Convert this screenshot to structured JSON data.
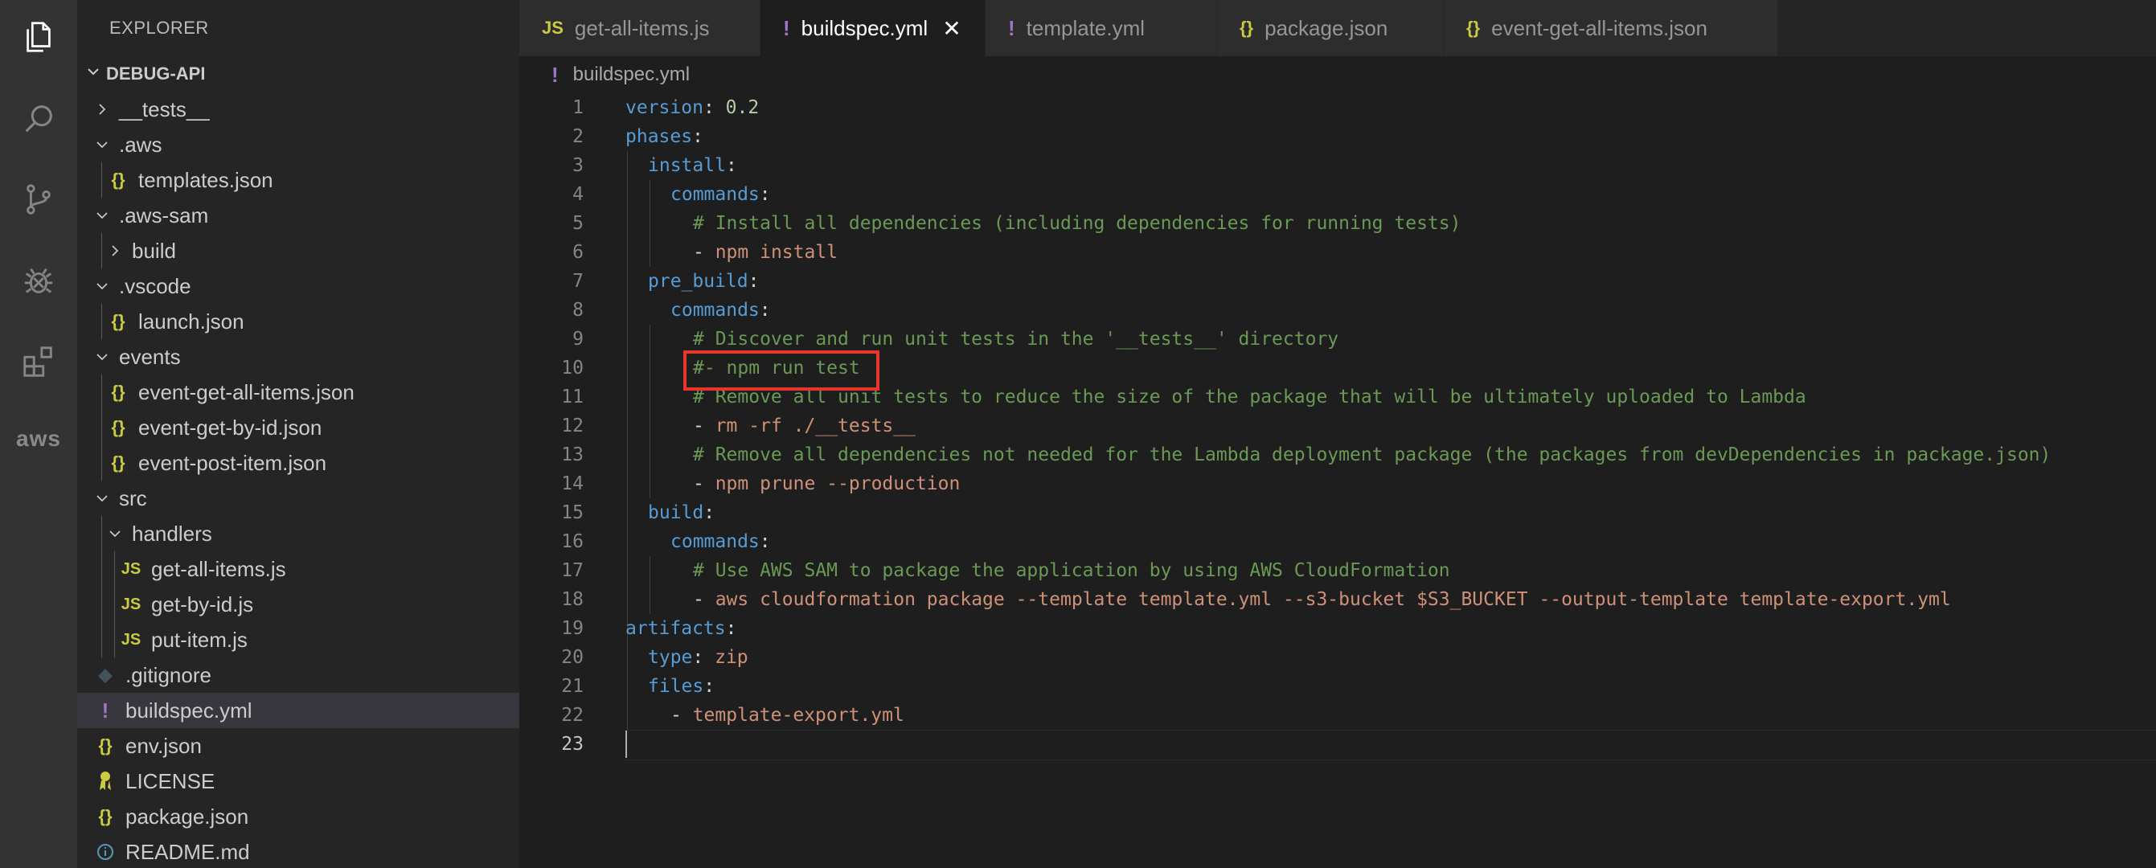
{
  "sidebar": {
    "title": "EXPLORER",
    "section": "DEBUG-API",
    "items": [
      {
        "label": "__tests__",
        "type": "folder-closed",
        "depth": 1
      },
      {
        "label": ".aws",
        "type": "folder-open",
        "depth": 1
      },
      {
        "label": "templates.json",
        "type": "json",
        "depth": 2
      },
      {
        "label": ".aws-sam",
        "type": "folder-open",
        "depth": 1
      },
      {
        "label": "build",
        "type": "folder-closed",
        "depth": 2
      },
      {
        "label": ".vscode",
        "type": "folder-open",
        "depth": 1
      },
      {
        "label": "launch.json",
        "type": "json",
        "depth": 2
      },
      {
        "label": "events",
        "type": "folder-open",
        "depth": 1
      },
      {
        "label": "event-get-all-items.json",
        "type": "json",
        "depth": 2
      },
      {
        "label": "event-get-by-id.json",
        "type": "json",
        "depth": 2
      },
      {
        "label": "event-post-item.json",
        "type": "json",
        "depth": 2
      },
      {
        "label": "src",
        "type": "folder-open",
        "depth": 1
      },
      {
        "label": "handlers",
        "type": "folder-open",
        "depth": 2
      },
      {
        "label": "get-all-items.js",
        "type": "js",
        "depth": 3
      },
      {
        "label": "get-by-id.js",
        "type": "js",
        "depth": 3
      },
      {
        "label": "put-item.js",
        "type": "js",
        "depth": 3
      },
      {
        "label": ".gitignore",
        "type": "git",
        "depth": 1
      },
      {
        "label": "buildspec.yml",
        "type": "yml",
        "depth": 1,
        "selected": true
      },
      {
        "label": "env.json",
        "type": "json",
        "depth": 1
      },
      {
        "label": "LICENSE",
        "type": "license",
        "depth": 1
      },
      {
        "label": "package.json",
        "type": "json",
        "depth": 1
      },
      {
        "label": "README.md",
        "type": "info",
        "depth": 1
      }
    ]
  },
  "tabs": [
    {
      "label": "get-all-items.js",
      "type": "js",
      "active": false
    },
    {
      "label": "buildspec.yml",
      "type": "yml",
      "active": true
    },
    {
      "label": "template.yml",
      "type": "yml",
      "active": false
    },
    {
      "label": "package.json",
      "type": "json",
      "active": false
    },
    {
      "label": "event-get-all-items.json",
      "type": "json",
      "active": false
    }
  ],
  "icons": {
    "json": "{}",
    "js": "JS",
    "yml": "!",
    "close": "✕"
  },
  "breadcrumb": "buildspec.yml",
  "activity_bar": {
    "aws_label": "aws"
  },
  "editor": {
    "active_line": 23,
    "highlighted_line": 10,
    "lines": [
      {
        "n": "1",
        "indent": 0,
        "tokens": [
          [
            "k",
            "version"
          ],
          [
            "p",
            ": "
          ],
          [
            "v",
            "0.2"
          ]
        ]
      },
      {
        "n": "2",
        "indent": 0,
        "tokens": [
          [
            "k",
            "phases"
          ],
          [
            "p",
            ":"
          ]
        ]
      },
      {
        "n": "3",
        "indent": 1,
        "tokens": [
          [
            "k",
            "install"
          ],
          [
            "p",
            ":"
          ]
        ]
      },
      {
        "n": "4",
        "indent": 2,
        "tokens": [
          [
            "k",
            "commands"
          ],
          [
            "p",
            ":"
          ]
        ]
      },
      {
        "n": "5",
        "indent": 3,
        "tokens": [
          [
            "c",
            "# Install all dependencies (including dependencies for running tests)"
          ]
        ]
      },
      {
        "n": "6",
        "indent": 3,
        "tokens": [
          [
            "p",
            "- "
          ],
          [
            "s",
            "npm install"
          ]
        ]
      },
      {
        "n": "7",
        "indent": 1,
        "tokens": [
          [
            "k",
            "pre_build"
          ],
          [
            "p",
            ":"
          ]
        ]
      },
      {
        "n": "8",
        "indent": 2,
        "tokens": [
          [
            "k",
            "commands"
          ],
          [
            "p",
            ":"
          ]
        ]
      },
      {
        "n": "9",
        "indent": 3,
        "tokens": [
          [
            "c",
            "# Discover and run unit tests in the '__tests__' directory"
          ]
        ]
      },
      {
        "n": "10",
        "indent": 3,
        "tokens": [
          [
            "c",
            "#- npm run test"
          ]
        ]
      },
      {
        "n": "11",
        "indent": 3,
        "tokens": [
          [
            "c",
            "# Remove all unit tests to reduce the size of the package that will be ultimately uploaded to Lambda"
          ]
        ]
      },
      {
        "n": "12",
        "indent": 3,
        "tokens": [
          [
            "p",
            "- "
          ],
          [
            "s",
            "rm -rf ./__tests__"
          ]
        ]
      },
      {
        "n": "13",
        "indent": 3,
        "tokens": [
          [
            "c",
            "# Remove all dependencies not needed for the Lambda deployment package (the packages from devDependencies in package.json)"
          ]
        ]
      },
      {
        "n": "14",
        "indent": 3,
        "tokens": [
          [
            "p",
            "- "
          ],
          [
            "s",
            "npm prune --production"
          ]
        ]
      },
      {
        "n": "15",
        "indent": 1,
        "tokens": [
          [
            "k",
            "build"
          ],
          [
            "p",
            ":"
          ]
        ]
      },
      {
        "n": "16",
        "indent": 2,
        "tokens": [
          [
            "k",
            "commands"
          ],
          [
            "p",
            ":"
          ]
        ]
      },
      {
        "n": "17",
        "indent": 3,
        "tokens": [
          [
            "c",
            "# Use AWS SAM to package the application by using AWS CloudFormation"
          ]
        ]
      },
      {
        "n": "18",
        "indent": 3,
        "tokens": [
          [
            "p",
            "- "
          ],
          [
            "s",
            "aws cloudformation package --template template.yml --s3-bucket $S3_BUCKET --output-template template-export.yml"
          ]
        ]
      },
      {
        "n": "19",
        "indent": 0,
        "tokens": [
          [
            "k",
            "artifacts"
          ],
          [
            "p",
            ":"
          ]
        ]
      },
      {
        "n": "20",
        "indent": 1,
        "tokens": [
          [
            "k",
            "type"
          ],
          [
            "p",
            ": "
          ],
          [
            "s",
            "zip"
          ]
        ]
      },
      {
        "n": "21",
        "indent": 1,
        "tokens": [
          [
            "k",
            "files"
          ],
          [
            "p",
            ":"
          ]
        ]
      },
      {
        "n": "22",
        "indent": 2,
        "tokens": [
          [
            "p",
            "- "
          ],
          [
            "s",
            "template-export.yml"
          ]
        ]
      },
      {
        "n": "23",
        "indent": 0,
        "tokens": []
      }
    ]
  }
}
